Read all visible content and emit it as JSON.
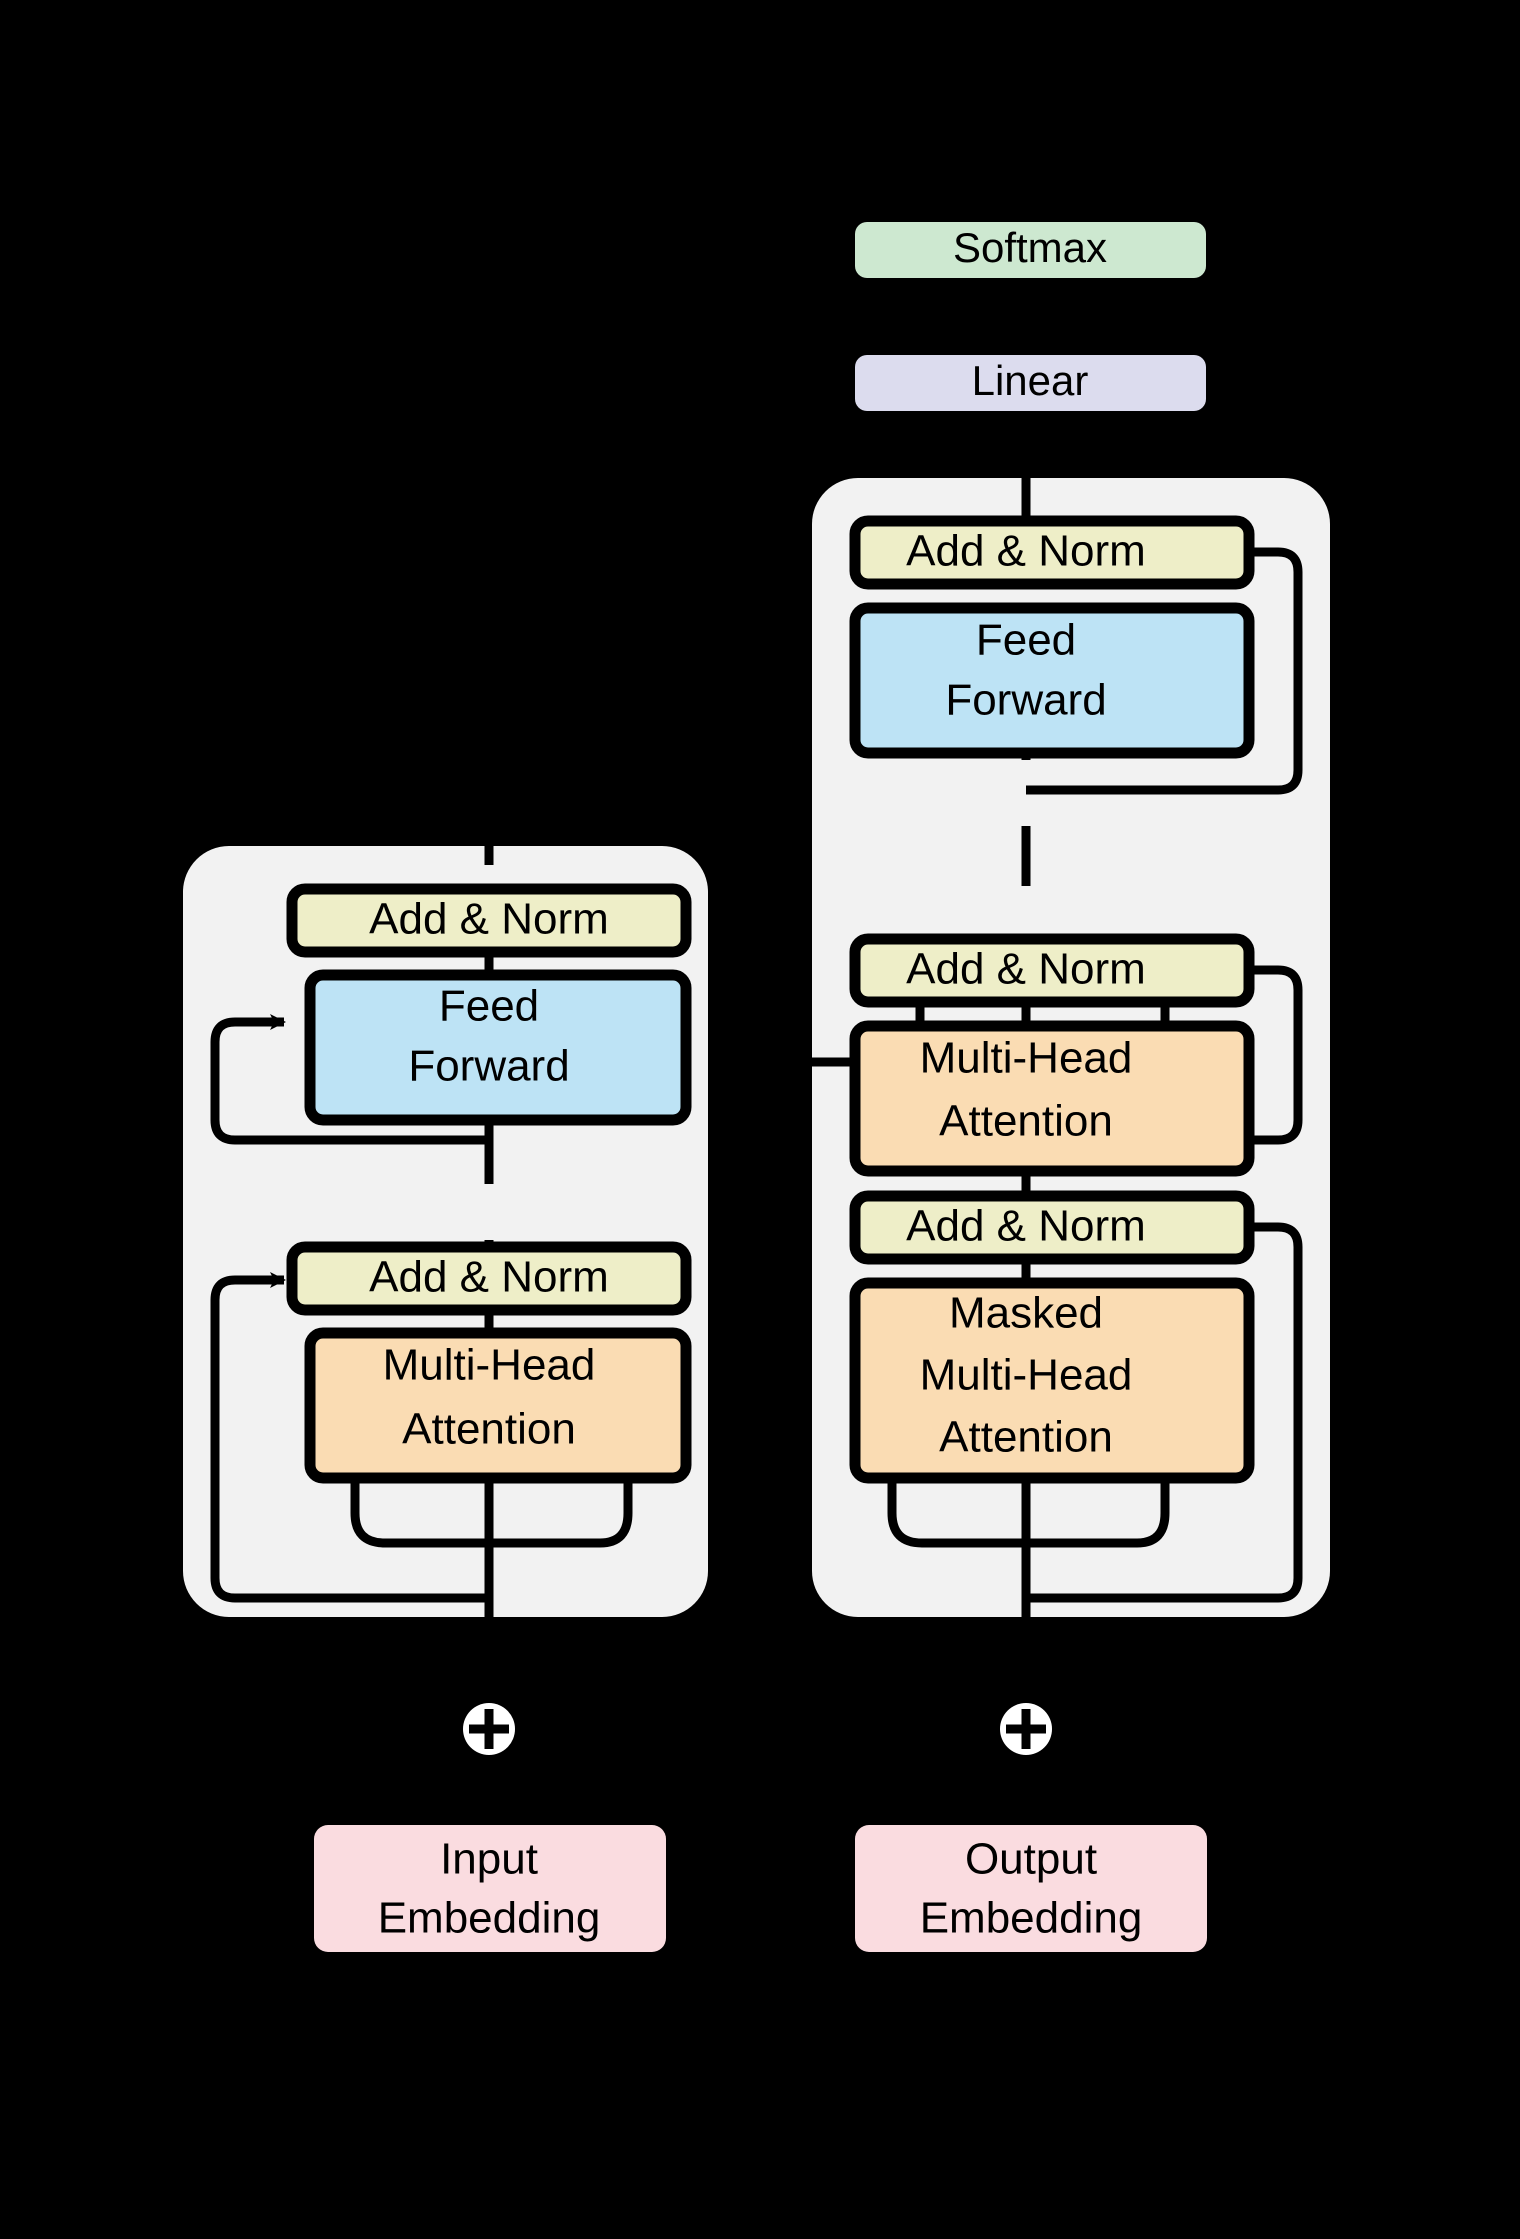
{
  "figure": {
    "type": "diagram",
    "subject": "Transformer model architecture (encoder-decoder)",
    "background_color": "#000000"
  },
  "palette": {
    "addnorm_fill": "#eeeec8",
    "feedforward_fill": "#bde3f5",
    "attention_fill": "#fadcb3",
    "embedding_fill": "#fadce0",
    "linear_fill": "#dcdcee",
    "softmax_fill": "#cde8d0",
    "stack_fill": "#f2f2f2",
    "stroke": "#000000",
    "plus_circle_fill": "#ffffff"
  },
  "encoder": {
    "name": "encoder-stack",
    "blocks": [
      {
        "id": "enc-add-norm-2",
        "label": "Add & Norm",
        "kind": "addnorm"
      },
      {
        "id": "enc-feed-forward",
        "label_line1": "Feed",
        "label_line2": "Forward",
        "kind": "feedforward"
      },
      {
        "id": "enc-add-norm-1",
        "label": "Add & Norm",
        "kind": "addnorm"
      },
      {
        "id": "enc-multi-head-attention",
        "label_line1": "Multi-Head",
        "label_line2": "Attention",
        "kind": "attention"
      }
    ]
  },
  "decoder": {
    "name": "decoder-stack",
    "blocks": [
      {
        "id": "dec-add-norm-3",
        "label": "Add & Norm",
        "kind": "addnorm"
      },
      {
        "id": "dec-feed-forward",
        "label_line1": "Feed",
        "label_line2": "Forward",
        "kind": "feedforward"
      },
      {
        "id": "dec-add-norm-2",
        "label": "Add & Norm",
        "kind": "addnorm"
      },
      {
        "id": "dec-cross-attention",
        "label_line1": "Multi-Head",
        "label_line2": "Attention",
        "kind": "attention"
      },
      {
        "id": "dec-add-norm-1",
        "label": "Add & Norm",
        "kind": "addnorm"
      },
      {
        "id": "dec-masked-attention",
        "label_line1": "Masked",
        "label_line2": "Multi-Head",
        "label_line3": "Attention",
        "kind": "attention"
      }
    ]
  },
  "head": {
    "softmax_label": "Softmax",
    "linear_label": "Linear"
  },
  "inputs": {
    "input_embedding_line1": "Input",
    "input_embedding_line2": "Embedding",
    "output_embedding_line1": "Output",
    "output_embedding_line2": "Embedding",
    "positional_add_symbol": "plus-circle"
  },
  "labels": {
    "enc_addnorm_2": "Add & Norm",
    "enc_ff_l1": "Feed",
    "enc_ff_l2": "Forward",
    "enc_addnorm_1": "Add & Norm",
    "enc_mha_l1": "Multi-Head",
    "enc_mha_l2": "Attention",
    "dec_addnorm_3": "Add & Norm",
    "dec_ff_l1": "Feed",
    "dec_ff_l2": "Forward",
    "dec_addnorm_2": "Add & Norm",
    "dec_mha_l1": "Multi-Head",
    "dec_mha_l2": "Attention",
    "dec_addnorm_1": "Add & Norm",
    "dec_masked_l1": "Masked",
    "dec_masked_l2": "Multi-Head",
    "dec_masked_l3": "Attention",
    "softmax": "Softmax",
    "linear": "Linear",
    "input_emb_l1": "Input",
    "input_emb_l2": "Embedding",
    "output_emb_l1": "Output",
    "output_emb_l2": "Embedding"
  }
}
